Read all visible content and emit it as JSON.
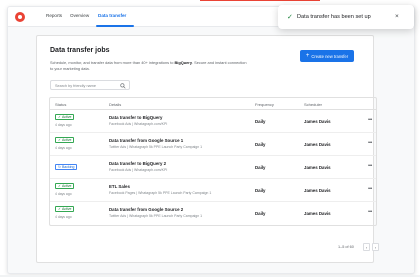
{
  "nav": {
    "tabs": [
      {
        "label": "Reports"
      },
      {
        "label": "Overview"
      },
      {
        "label": "Data transfer"
      }
    ]
  },
  "page": {
    "title": "Data transfer jobs",
    "description_pre": "Schedule, monitor, and transfer data from more than 40+ integrations to ",
    "description_bold": "BigQuery",
    "description_post": ". Secure and instant connection to your marketing data."
  },
  "search": {
    "placeholder": "Search by friendly name"
  },
  "create_button": {
    "label": "Create new transfer",
    "icon": "plus-icon"
  },
  "table": {
    "headers": {
      "status": "Status",
      "details": "Details",
      "frequency": "Frequency",
      "scheduler": "Scheduler"
    },
    "rows": [
      {
        "status": "Active",
        "ago": "4 days ago",
        "title": "Data transfer to BigQuery",
        "sub": "Facebook Ads | Whatagraph.com/KPI",
        "frequency": "Daily",
        "scheduler": "James Davis"
      },
      {
        "status": "Active",
        "ago": "4 days ago",
        "title": "Data transfer from Google Source 1",
        "sub": "Twitter Ads | Whatagraph 5k PPE Launch Party Campaign 1",
        "frequency": "Daily",
        "scheduler": "James Davis"
      },
      {
        "status": "Backing",
        "ago": "",
        "title": "Data transfer to BigQuery 2",
        "sub": "Facebook Ads | Whatagraph.com/KPI",
        "frequency": "Daily",
        "scheduler": "James Davis"
      },
      {
        "status": "Active",
        "ago": "4 days ago",
        "title": "ETL Sales",
        "sub": "Facebook Pages | Whatagraph 5k PPE Launch Party Campaign 1",
        "frequency": "Daily",
        "scheduler": "James Davis"
      },
      {
        "status": "Active",
        "ago": "4 days ago",
        "title": "Data transfer from Google Source 2",
        "sub": "Twitter Ads | Whatagraph 5k PPE Launch Party Campaign 1",
        "frequency": "Daily",
        "scheduler": "James Davis"
      }
    ]
  },
  "pagination": {
    "text": "1–5 of 60",
    "prev": "‹",
    "next": "›"
  },
  "toast": {
    "message": "Data transfer has been set up",
    "close": "×"
  },
  "colors": {
    "accent": "#1a73e8",
    "success": "#34a853",
    "logo": "#ea4335"
  }
}
